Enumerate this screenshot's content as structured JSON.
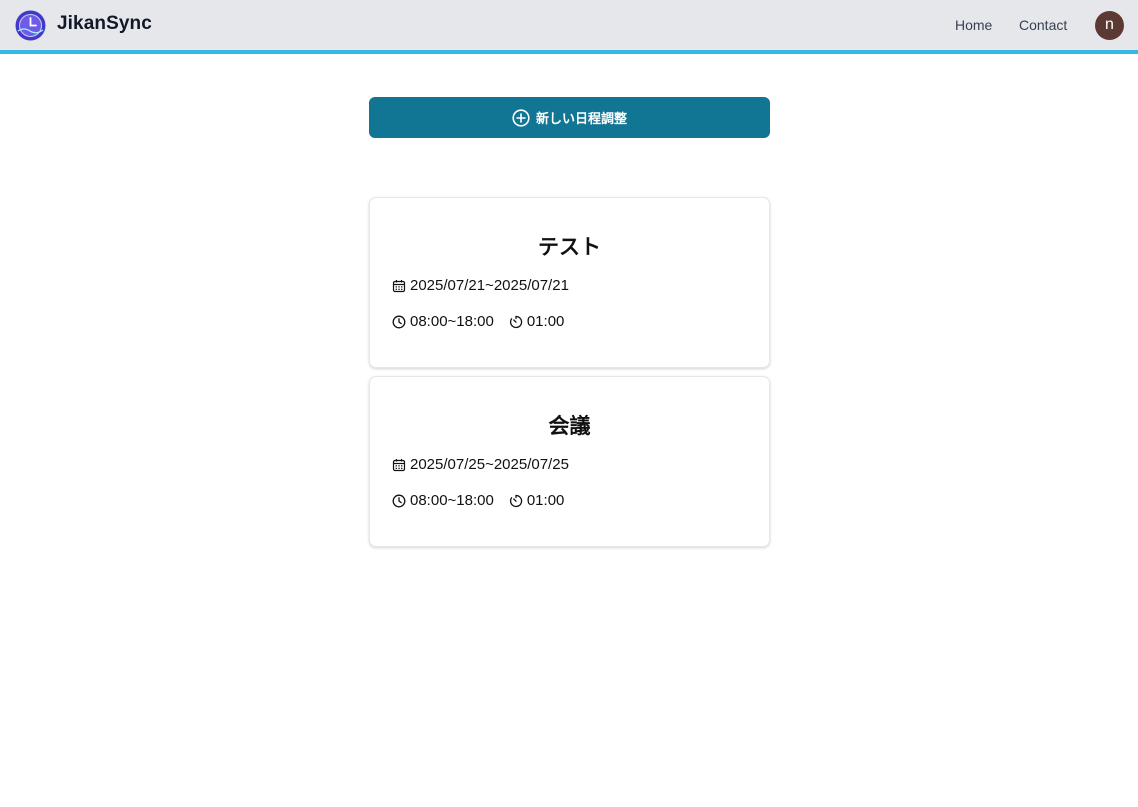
{
  "header": {
    "brand": "JikanSync",
    "nav": {
      "home": "Home",
      "contact": "Contact"
    },
    "avatar_initial": "n"
  },
  "main": {
    "new_button_label": "新しい日程調整",
    "events": [
      {
        "title": "テスト",
        "date_range": "2025/07/21~2025/07/21",
        "time_range": "08:00~18:00",
        "duration": "01:00"
      },
      {
        "title": "会議",
        "date_range": "2025/07/25~2025/07/25",
        "time_range": "08:00~18:00",
        "duration": "01:00"
      }
    ]
  },
  "colors": {
    "header_bg": "#e5e7eb",
    "header_accent": "#38b6e6",
    "primary_button": "#117694",
    "avatar_bg": "#5b3a33",
    "logo": "#4338ca"
  },
  "icons": [
    "clock-logo-icon",
    "plus-circle-icon",
    "calendar-icon",
    "clock-icon",
    "timer-icon"
  ]
}
